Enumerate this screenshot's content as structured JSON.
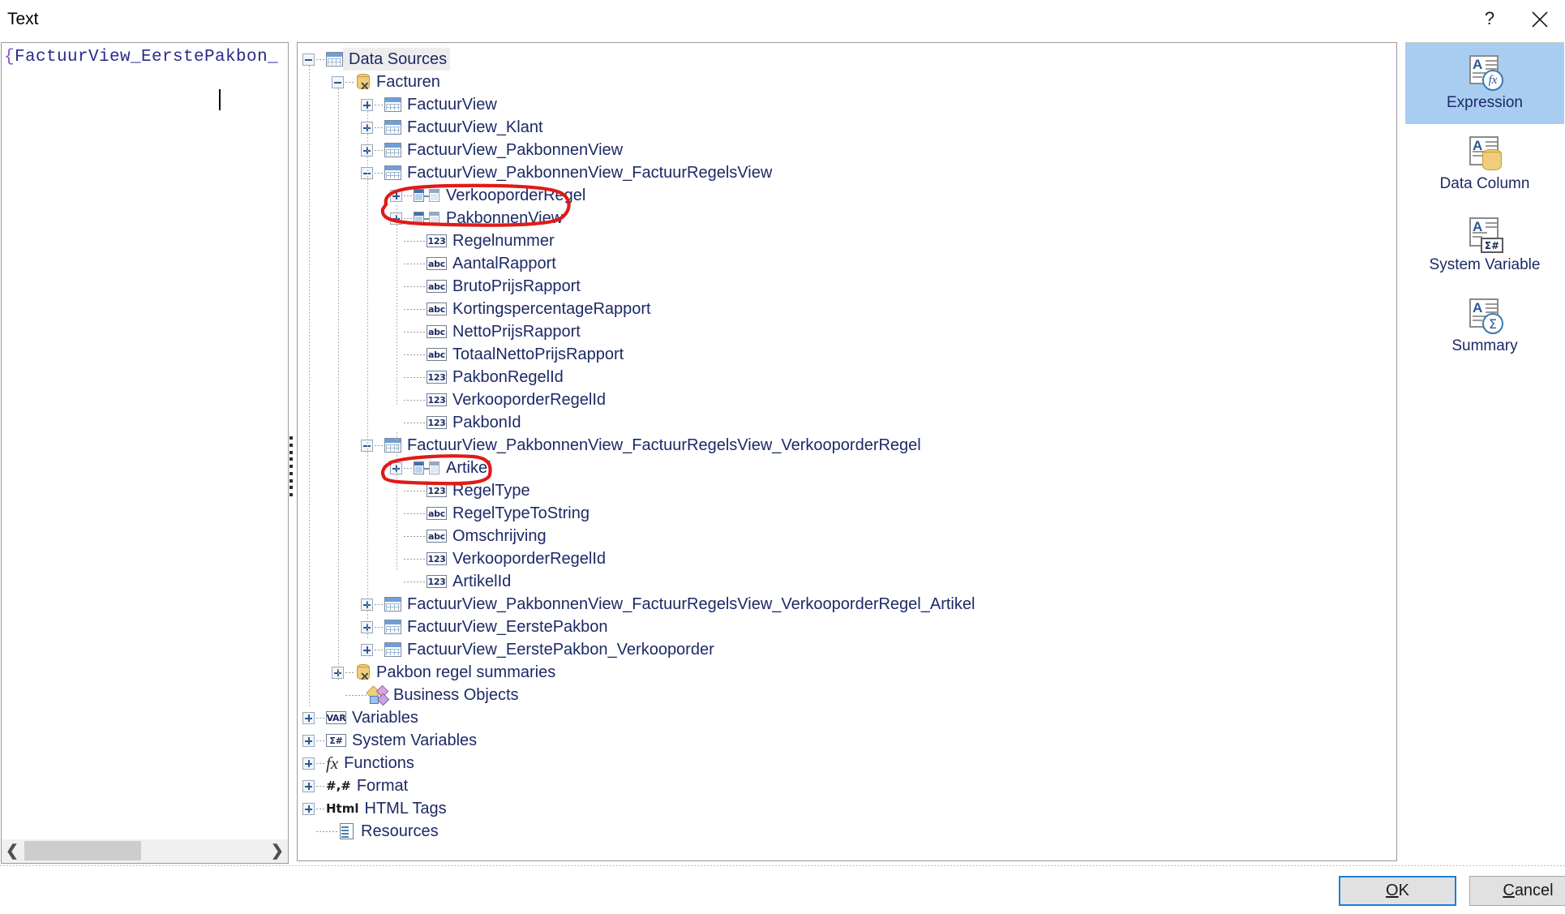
{
  "window": {
    "title": "Text",
    "help_icon": "question-mark-icon",
    "close_icon": "close-icon"
  },
  "editor": {
    "value": "{FactuurView_EerstePakbon_",
    "prefix": "{",
    "body": "FactuurView_EerstePakbon_",
    "scrollbar": {
      "left_arrow": "❮",
      "right_arrow": "❯"
    }
  },
  "tree": {
    "nodes": [
      {
        "label": "Data Sources",
        "depth": 0,
        "icon": "table-icon",
        "expander": "minus",
        "selected": true
      },
      {
        "label": "Facturen",
        "depth": 1,
        "icon": "database-disconnected-icon",
        "expander": "minus",
        "selected": false
      },
      {
        "label": "FactuurView",
        "depth": 2,
        "icon": "table-icon",
        "expander": "plus",
        "selected": false
      },
      {
        "label": "FactuurView_Klant",
        "depth": 2,
        "icon": "table-icon",
        "expander": "plus",
        "selected": false
      },
      {
        "label": "FactuurView_PakbonnenView",
        "depth": 2,
        "icon": "table-icon",
        "expander": "plus",
        "selected": false
      },
      {
        "label": "FactuurView_PakbonnenView_FactuurRegelsView",
        "depth": 2,
        "icon": "table-icon",
        "expander": "minus",
        "selected": false
      },
      {
        "label": "VerkooporderRegel",
        "depth": 3,
        "icon": "relation-icon",
        "expander": "plus",
        "selected": false
      },
      {
        "label": "PakbonnenView",
        "depth": 3,
        "icon": "relation-icon",
        "expander": "plus",
        "selected": false
      },
      {
        "label": "Regelnummer",
        "depth": 3,
        "icon": "numeric-field-icon",
        "icon_text": "123",
        "expander": "none",
        "selected": false
      },
      {
        "label": "AantalRapport",
        "depth": 3,
        "icon": "text-field-icon",
        "icon_text": "abc",
        "expander": "none",
        "selected": false
      },
      {
        "label": "BrutoPrijsRapport",
        "depth": 3,
        "icon": "text-field-icon",
        "icon_text": "abc",
        "expander": "none",
        "selected": false
      },
      {
        "label": "KortingspercentageRapport",
        "depth": 3,
        "icon": "text-field-icon",
        "icon_text": "abc",
        "expander": "none",
        "selected": false
      },
      {
        "label": "NettoPrijsRapport",
        "depth": 3,
        "icon": "text-field-icon",
        "icon_text": "abc",
        "expander": "none",
        "selected": false
      },
      {
        "label": "TotaalNettoPrijsRapport",
        "depth": 3,
        "icon": "text-field-icon",
        "icon_text": "abc",
        "expander": "none",
        "selected": false
      },
      {
        "label": "PakbonRegelId",
        "depth": 3,
        "icon": "numeric-field-icon",
        "icon_text": "123",
        "expander": "none",
        "selected": false
      },
      {
        "label": "VerkooporderRegelId",
        "depth": 3,
        "icon": "numeric-field-icon",
        "icon_text": "123",
        "expander": "none",
        "selected": false
      },
      {
        "label": "PakbonId",
        "depth": 3,
        "icon": "numeric-field-icon",
        "icon_text": "123",
        "expander": "none",
        "selected": false
      },
      {
        "label": "FactuurView_PakbonnenView_FactuurRegelsView_VerkooporderRegel",
        "depth": 2,
        "icon": "table-icon",
        "expander": "minus",
        "selected": false
      },
      {
        "label": "Artikel",
        "depth": 3,
        "icon": "relation-icon",
        "expander": "plus",
        "selected": false
      },
      {
        "label": "RegelType",
        "depth": 3,
        "icon": "numeric-field-icon",
        "icon_text": "123",
        "expander": "none",
        "selected": false
      },
      {
        "label": "RegelTypeToString",
        "depth": 3,
        "icon": "text-field-icon",
        "icon_text": "abc",
        "expander": "none",
        "selected": false
      },
      {
        "label": "Omschrijving",
        "depth": 3,
        "icon": "text-field-icon",
        "icon_text": "abc",
        "expander": "none",
        "selected": false
      },
      {
        "label": "VerkooporderRegelId",
        "depth": 3,
        "icon": "numeric-field-icon",
        "icon_text": "123",
        "expander": "none",
        "selected": false
      },
      {
        "label": "ArtikelId",
        "depth": 3,
        "icon": "numeric-field-icon",
        "icon_text": "123",
        "expander": "none",
        "selected": false
      },
      {
        "label": "FactuurView_PakbonnenView_FactuurRegelsView_VerkooporderRegel_Artikel",
        "depth": 2,
        "icon": "table-icon",
        "expander": "plus",
        "selected": false
      },
      {
        "label": "FactuurView_EerstePakbon",
        "depth": 2,
        "icon": "table-icon",
        "expander": "plus",
        "selected": false
      },
      {
        "label": "FactuurView_EerstePakbon_Verkooporder",
        "depth": 2,
        "icon": "table-icon",
        "expander": "plus",
        "selected": false
      },
      {
        "label": "Pakbon regel summaries",
        "depth": 1,
        "icon": "database-disconnected-icon",
        "expander": "plus",
        "selected": false
      },
      {
        "label": "Business Objects",
        "depth": 1,
        "icon": "business-objects-icon",
        "expander": "none",
        "selected": false
      },
      {
        "label": "Variables",
        "depth": 0,
        "icon": "var-icon",
        "icon_text": "VAR",
        "expander": "plus",
        "selected": false
      },
      {
        "label": "System Variables",
        "depth": 0,
        "icon": "sigma-hash-icon",
        "icon_text": "Σ#",
        "expander": "plus",
        "selected": false
      },
      {
        "label": "Functions",
        "depth": 0,
        "icon": "fx-icon",
        "icon_text": "fx",
        "expander": "plus",
        "selected": false
      },
      {
        "label": "Format",
        "depth": 0,
        "icon": "number-format-icon",
        "icon_text": "#,#",
        "expander": "plus",
        "selected": false
      },
      {
        "label": "HTML Tags",
        "depth": 0,
        "icon": "html-icon",
        "icon_text": "Html",
        "expander": "plus",
        "selected": false
      },
      {
        "label": "Resources",
        "depth": 0,
        "icon": "resources-icon",
        "expander": "none",
        "selected": false
      }
    ]
  },
  "categories": {
    "items": [
      {
        "label": "Expression",
        "icon": "expression-icon",
        "badge": "fx",
        "active": true
      },
      {
        "label": "Data Column",
        "icon": "data-column-icon",
        "badge": "",
        "active": false
      },
      {
        "label": "System Variable",
        "icon": "system-variable-icon",
        "badge": "Σ#",
        "active": false
      },
      {
        "label": "Summary",
        "icon": "summary-icon",
        "badge": "Σ",
        "active": false
      }
    ]
  },
  "footer": {
    "ok": {
      "accel": "O",
      "rest": "K"
    },
    "cancel": {
      "accel": "C",
      "rest": "ancel"
    }
  },
  "annotations": {
    "color": "#e01b18",
    "shapes": [
      "ellipse-around-verkooporderregel-pakbonnenview",
      "ellipse-around-artikel"
    ]
  }
}
